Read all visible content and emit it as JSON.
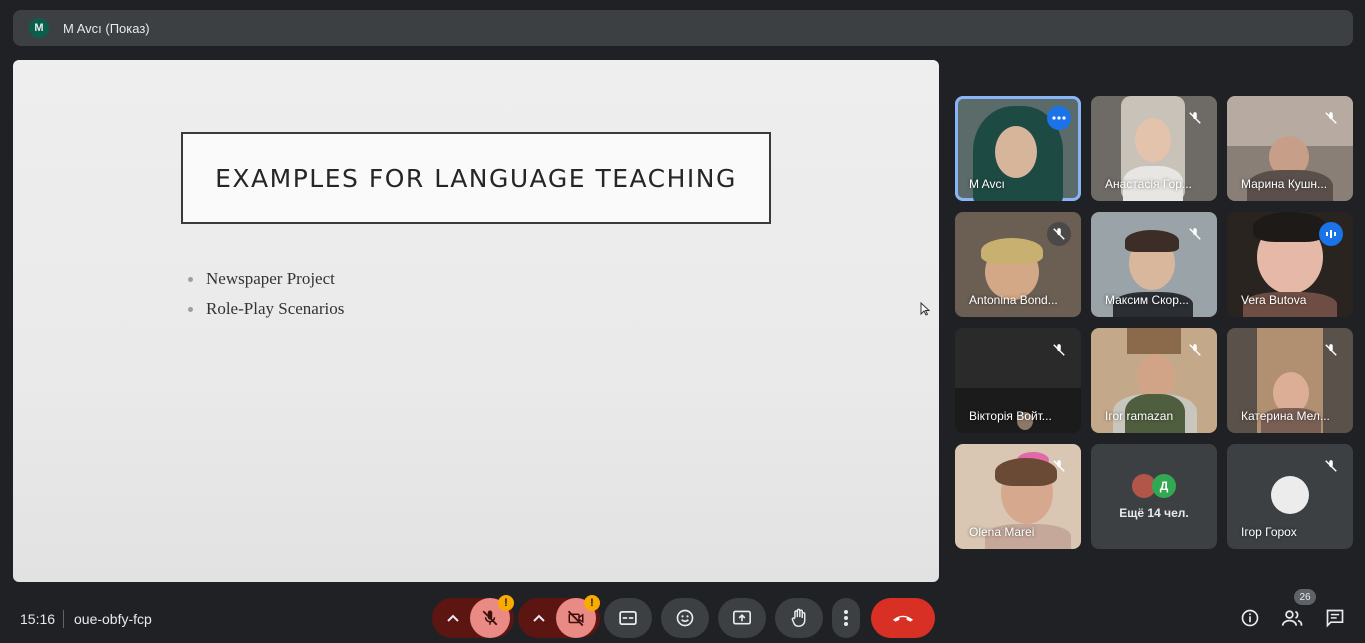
{
  "topbar": {
    "avatar_letter": "M",
    "presenter": "M Avcı (Показ)"
  },
  "slide": {
    "title": "EXAMPLES FOR LANGUAGE TEACHING",
    "bullets": [
      "Newspaper Project",
      "Role-Play Scenarios"
    ]
  },
  "participants": [
    {
      "name": "M Avcı",
      "status": "more-options"
    },
    {
      "name": "Анастасія Гор...",
      "status": "muted"
    },
    {
      "name": "Марина Кушн...",
      "status": "muted"
    },
    {
      "name": "Antonina Bond...",
      "status": "muted"
    },
    {
      "name": "Максим Скор...",
      "status": "muted"
    },
    {
      "name": "Vera Butova",
      "status": "speaking"
    },
    {
      "name": "Вікторія Войт...",
      "status": "muted"
    },
    {
      "name": "Iгоr ramazan",
      "status": "muted"
    },
    {
      "name": "Катерина Мел...",
      "status": "muted"
    },
    {
      "name": "Olena Marei",
      "status": "muted"
    },
    {
      "name": "Ещё 14 чел.",
      "status": "overflow",
      "mini_letter": "Д"
    },
    {
      "name": "Ігор Горох",
      "status": "muted"
    }
  ],
  "bottom": {
    "time": "15:16",
    "meeting_code": "oue-obfy-fcp",
    "warn_mark": "!",
    "people_count": "26"
  },
  "colors": {
    "background": "#202124",
    "tile": "#3c4043",
    "active_outline": "#8ab4f8",
    "hangup": "#d93025",
    "muted_control": "#ea8a84",
    "warning": "#f9ab00"
  },
  "icons": {
    "toolbar": [
      "chevron-up-icon",
      "mic-off-icon",
      "chevron-up-icon",
      "camera-off-icon",
      "captions-icon",
      "emoji-icon",
      "present-screen-icon",
      "raise-hand-icon",
      "more-vert-icon",
      "call-end-icon"
    ],
    "right": [
      "info-icon",
      "people-icon",
      "chat-icon"
    ]
  }
}
